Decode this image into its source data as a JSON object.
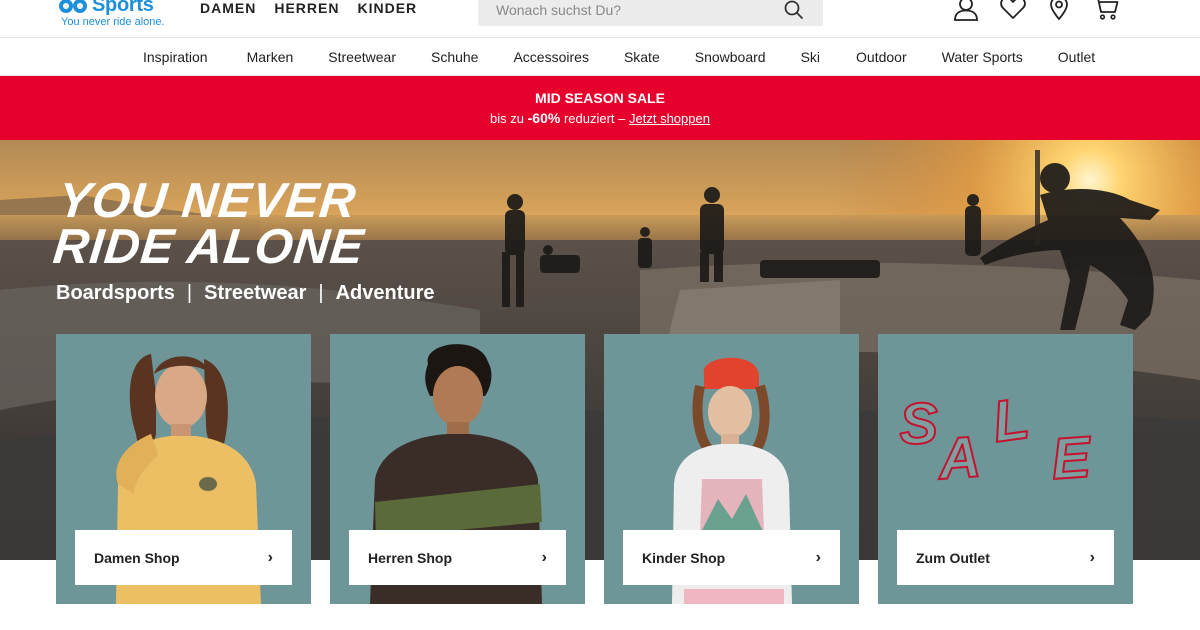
{
  "header": {
    "logo_text": "Sports",
    "logo_tagline": "You never ride alone.",
    "gender_nav": [
      "DAMEN",
      "HERREN",
      "KINDER"
    ],
    "search_placeholder": "Wonach suchst Du?",
    "icons": [
      "account-icon",
      "wishlist-heart-icon",
      "store-locator-icon",
      "cart-icon"
    ]
  },
  "category_nav": [
    "Inspiration",
    "Marken",
    "Streetwear",
    "Schuhe",
    "Accessoires",
    "Skate",
    "Snowboard",
    "Ski",
    "Outdoor",
    "Water Sports",
    "Outlet"
  ],
  "promo": {
    "title": "MID SEASON SALE",
    "prefix": "bis zu",
    "discount": "-60%",
    "suffix": "reduziert –",
    "link": "Jetzt shoppen",
    "color": "#e8002d"
  },
  "hero": {
    "headline_line1": "YOU NEVER",
    "headline_line2": "RIDE ALONE",
    "sub": [
      "Boardsports",
      "Streetwear",
      "Adventure"
    ],
    "sub_separator": "|"
  },
  "tiles": [
    {
      "label": "Damen Shop",
      "chevron": "›"
    },
    {
      "label": "Herren Shop",
      "chevron": "›"
    },
    {
      "label": "Kinder Shop",
      "chevron": "›"
    },
    {
      "label": "Zum Outlet",
      "chevron": "›",
      "graphic_text": "SALE"
    }
  ],
  "colors": {
    "brand_blue": "#1e8fd9",
    "tile_bg": "#6e9597",
    "sale_red": "#c4122f"
  }
}
